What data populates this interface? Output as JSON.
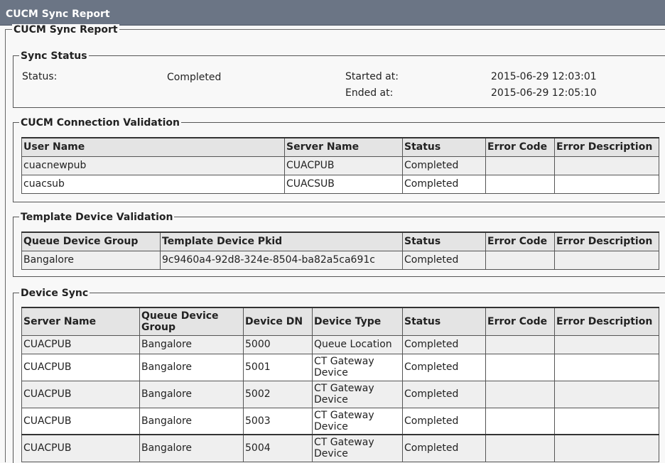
{
  "window": {
    "title": "CUCM Sync Report"
  },
  "report": {
    "legend": "CUCM Sync Report"
  },
  "sync_status": {
    "legend": "Sync Status",
    "status_label": "Status:",
    "status_value": "Completed",
    "started_label": "Started at:",
    "started_value": "2015-06-29 12:03:01",
    "ended_label": "Ended at:",
    "ended_value": "2015-06-29 12:05:10"
  },
  "connection_validation": {
    "legend": "CUCM Connection Validation",
    "headers": [
      "User Name",
      "Server Name",
      "Status",
      "Error Code",
      "Error Description"
    ],
    "rows": [
      [
        "cuacnewpub",
        "CUACPUB",
        "Completed",
        "",
        ""
      ],
      [
        "cuacsub",
        "CUACSUB",
        "Completed",
        "",
        ""
      ]
    ]
  },
  "template_validation": {
    "legend": "Template Device Validation",
    "headers": [
      "Queue Device Group",
      "Template Device Pkid",
      "Status",
      "Error Code",
      "Error Description"
    ],
    "rows": [
      [
        "Bangalore",
        "9c9460a4-92d8-324e-8504-ba82a5ca691c",
        "Completed",
        "",
        ""
      ]
    ]
  },
  "device_sync": {
    "legend": "Device Sync",
    "headers": [
      "Server Name",
      "Queue Device Group",
      "Device DN",
      "Device Type",
      "Status",
      "Error Code",
      "Error Description"
    ],
    "rows": [
      [
        "CUACPUB",
        "Bangalore",
        "5000",
        "Queue Location",
        "Completed",
        "",
        ""
      ],
      [
        "CUACPUB",
        "Bangalore",
        "5001",
        "CT Gateway Device",
        "Completed",
        "",
        ""
      ],
      [
        "CUACPUB",
        "Bangalore",
        "5002",
        "CT Gateway Device",
        "Completed",
        "",
        ""
      ],
      [
        "CUACPUB",
        "Bangalore",
        "5003",
        "CT Gateway Device",
        "Completed",
        "",
        ""
      ],
      [
        "CUACPUB",
        "Bangalore",
        "5004",
        "CT Gateway Device",
        "Completed",
        "",
        ""
      ]
    ]
  }
}
